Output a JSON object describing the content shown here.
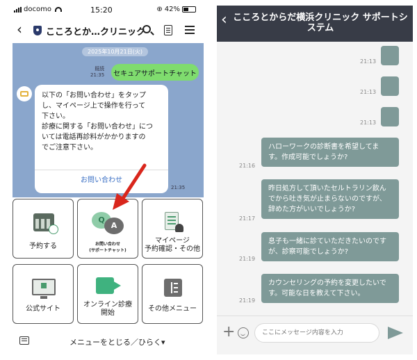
{
  "left": {
    "status": {
      "carrier": "docomo",
      "time": "15:20",
      "battery": "42%",
      "battery_level": 0.42
    },
    "nav": {
      "title": "こころとか…クリニック"
    },
    "chat": {
      "date": "2025年10月21日(火)",
      "read_label": "既読",
      "sent_time": "21:35",
      "my_message": "セキュアサポートチャット",
      "bot_lines": [
        "以下の「お問い合わせ」をタップ",
        "し、マイページ上で操作を行って",
        "下さい。",
        "診療に関する「お問い合わせ」につ",
        "いては電話再診料がかかりますの",
        "でご注意下さい。"
      ],
      "bot_link": "お問い合わせ",
      "bot_time": "21:35"
    },
    "menu": {
      "reserve": "予約する",
      "inquiry_line1": "お問い合わせ",
      "inquiry_line2": "(サポートチャット)",
      "mypage_line1": "マイページ",
      "mypage_line2": "予約確認・その他",
      "site": "公式サイト",
      "online_line1": "オンライン診療",
      "online_line2": "開始",
      "other": "その他メニュー",
      "qa_q": "Q",
      "qa_a": "A"
    },
    "bottom": {
      "toggle": "メニューをとじる／ひらく▾"
    }
  },
  "right": {
    "header": {
      "title": "こころとからだ横浜クリニック サポートシステム"
    },
    "messages": [
      {
        "time": "21:13"
      },
      {
        "time": "21:13"
      },
      {
        "time": "21:13"
      },
      {
        "time": "21:16",
        "text": "ハローワークの診断書を希望してます。作成可能でしょうか?"
      },
      {
        "time": "21:17",
        "text": "昨日処方して頂いたセルトラリン飲んでから吐き気が止まらないのですが、辞めた方がいいでしょうか?"
      },
      {
        "time": "21:19",
        "text": "息子も一緒に診ていただきたいのですが、診察可能でしょうか?"
      },
      {
        "time": "21:19",
        "text": "カウンセリングの予約を変更したいです。可能な日を教えて下さい。"
      }
    ],
    "input": {
      "placeholder": "ここにメッセージ内容を入力"
    }
  }
}
